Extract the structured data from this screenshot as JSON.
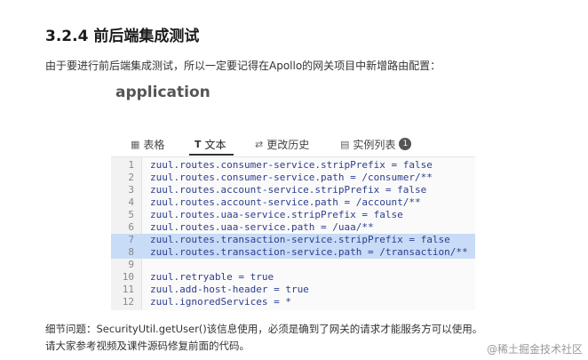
{
  "heading": "3.2.4 前后端集成测试",
  "intro": "由于要进行前后端集成测试，所以一定要记得在Apollo的网关项目中新增路由配置：",
  "app": {
    "title": "application",
    "tabs": [
      {
        "label": "表格",
        "icon": "table-icon"
      },
      {
        "label": "文本",
        "icon": "text-icon"
      },
      {
        "label": "更改历史",
        "icon": "history-icon"
      },
      {
        "label": "实例列表",
        "icon": "instances-icon",
        "badge": "1"
      }
    ],
    "lines": [
      {
        "n": "1",
        "text": "zuul.routes.consumer-service.stripPrefix = false"
      },
      {
        "n": "2",
        "text": "zuul.routes.consumer-service.path = /consumer/**"
      },
      {
        "n": "3",
        "text": "zuul.routes.account-service.stripPrefix = false"
      },
      {
        "n": "4",
        "text": "zuul.routes.account-service.path = /account/**"
      },
      {
        "n": "5",
        "text": "zuul.routes.uaa-service.stripPrefix = false"
      },
      {
        "n": "6",
        "text": "zuul.routes.uaa-service.path = /uaa/**"
      },
      {
        "n": "7",
        "text": "zuul.routes.transaction-service.stripPrefix = false"
      },
      {
        "n": "8",
        "text": "zuul.routes.transaction-service.path = /transaction/**"
      },
      {
        "n": "9",
        "text": ""
      },
      {
        "n": "10",
        "text": "zuul.retryable = true"
      },
      {
        "n": "11",
        "text": "zuul.add-host-header = true"
      },
      {
        "n": "12",
        "text": "zuul.ignoredServices = *"
      }
    ]
  },
  "footer": {
    "line1": "细节问题：SecurityUtil.getUser()该信息使用，必须是确到了网关的请求才能服务方可以使用。",
    "line2": "请大家参考视频及课件源码修复前面的代码。"
  },
  "watermark": "@稀土掘金技术社区"
}
